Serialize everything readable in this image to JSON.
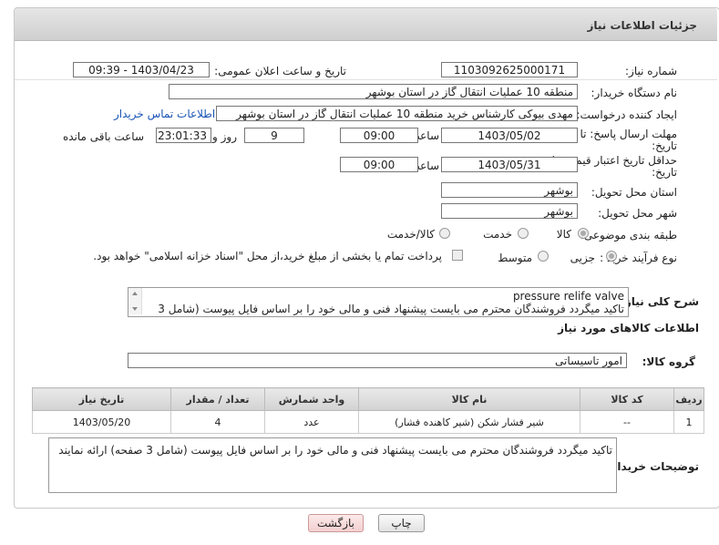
{
  "header": {
    "title": "جزئیات اطلاعات نیاز"
  },
  "fields": {
    "need_number_label": "شماره نیاز:",
    "need_number": "1103092625000171",
    "announce_label": "تاریخ و ساعت اعلان عمومی:",
    "announce_value": "1403/04/23 - 09:39",
    "buyer_org_label": "نام دستگاه خریدار:",
    "buyer_org": "منطقه 10 عملیات انتقال گاز در استان بوشهر",
    "creator_label": "ایجاد کننده درخواست:",
    "creator": "مهدی بیوکی کارشناس خرید منطقه 10 عملیات انتقال گاز در استان بوشهر",
    "contact_link": "اطلاعات تماس خریدار",
    "deadline_label": "مهلت ارسال پاسخ: تا",
    "deadline_label2": "تاریخ:",
    "deadline_date": "1403/05/02",
    "time_label": "ساعت",
    "deadline_time": "09:00",
    "days": "9",
    "days_label": "روز و",
    "remaining_time": "23:01:33",
    "remaining_label": "ساعت باقی مانده",
    "validity_label": "حداقل تاریخ اعتبار قیمت: تا",
    "validity_label2": "تاریخ:",
    "validity_date": "1403/05/31",
    "validity_time": "09:00",
    "province_label": "استان محل تحویل:",
    "province": "بوشهر",
    "city_label": "شهر محل تحویل:",
    "city": "بوشهر",
    "category_label": "طبقه بندی موضوعی:",
    "category_options": [
      "کالا",
      "خدمت",
      "کالا/خدمت"
    ],
    "purchase_label": "نوع فرآیند خرید :",
    "purchase_options": [
      "جزیی",
      "متوسط"
    ],
    "payment_note": "پرداخت تمام یا بخشی از مبلغ خرید،از محل \"اسناد خزانه اسلامی\" خواهد بود."
  },
  "description": {
    "label": "شرح کلی نیاز:",
    "line1": "pressure relife valve",
    "line2": "تاکید میگردد فروشندگان محترم می بایست پیشنهاد فنی و مالی خود را بر اساس فایل پیوست (شامل 3"
  },
  "goods": {
    "section_title": "اطلاعات کالاهای مورد نیاز",
    "group_label": "گروه کالا:",
    "group_value": "امور تاسیساتی",
    "columns": [
      "ردیف",
      "کد کالا",
      "نام کالا",
      "واحد شمارش",
      "تعداد / مقدار",
      "تاریخ نیاز"
    ],
    "rows": [
      {
        "row": "1",
        "code": "--",
        "name": "شیر فشار شکن (شیر کاهنده فشار)",
        "unit": "عدد",
        "qty": "4",
        "date": "1403/05/20"
      }
    ]
  },
  "buyer_notes": {
    "label": "توضیحات خریدار:",
    "text": "تاکید میگردد فروشندگان محترم می بایست پیشنهاد فنی و مالی خود را بر اساس فایل پیوست (شامل 3 صفحه) ارائه نمایند"
  },
  "buttons": {
    "print": "چاپ",
    "back": "بازگشت"
  },
  "colors": {
    "link": "#1a55b5",
    "header_bg": "#d6d6d6",
    "back_button": "#f3cfcf"
  }
}
